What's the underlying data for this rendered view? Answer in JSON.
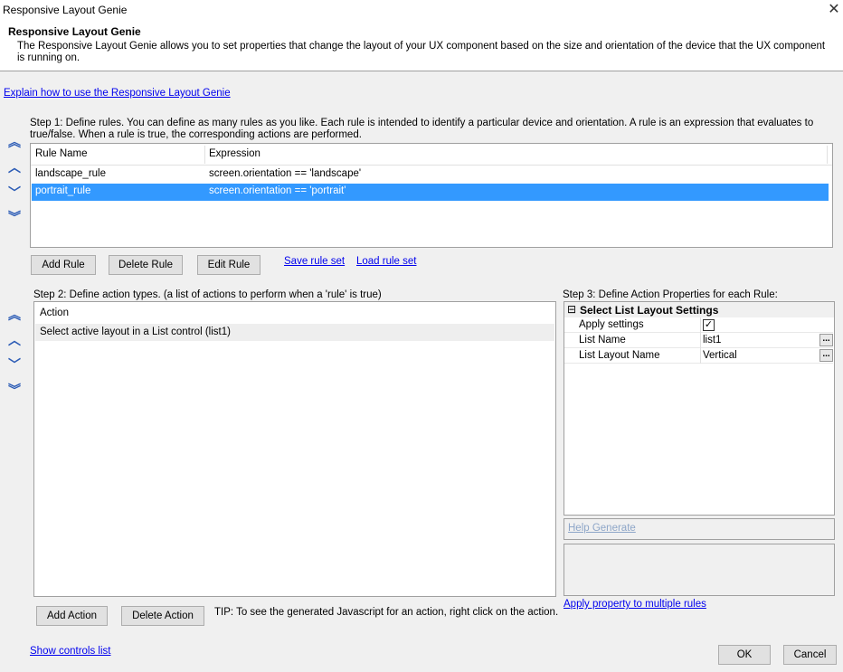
{
  "window": {
    "title": "Responsive Layout Genie",
    "close_glyph": "✕"
  },
  "header": {
    "title": "Responsive Layout Genie",
    "description": "The Responsive Layout Genie allows you to set properties that change the layout of your UX component based on the size and orientation of the device that the UX component is running on."
  },
  "explain_link": "Explain how to use the Responsive Layout Genie",
  "step1": {
    "instructions": "Step 1: Define rules. You can define as many rules as you like. Each rule is intended to identify a particular device and orientation. A rule is an expression that evaluates to true/false. When a rule is true, the corresponding actions are performed.",
    "columns": [
      "Rule Name",
      "Expression"
    ],
    "rows": [
      {
        "name": "landscape_rule",
        "expression": "screen.orientation == 'landscape'"
      },
      {
        "name": "portrait_rule",
        "expression": "screen.orientation == 'portrait'"
      }
    ],
    "selected_row": 1,
    "add_rule": "Add Rule",
    "delete_rule": "Delete Rule",
    "edit_rule": "Edit Rule",
    "save_rule_set": "Save rule set",
    "load_rule_set": "Load rule set"
  },
  "move_arrows": {
    "top": "︽",
    "up": "︿",
    "down": "﹀",
    "bottom": "︾"
  },
  "step2": {
    "instructions": "Step 2: Define action types.  (a list of actions to perform when a 'rule' is true)",
    "column": "Action",
    "rows": [
      "Select active layout in a List control (list1)"
    ],
    "add_action": "Add Action",
    "delete_action": "Delete Action",
    "tip": "TIP: To see the generated Javascript for an action, right click on the action."
  },
  "step3": {
    "instructions": "Step 3: Define Action Properties for each Rule:",
    "group_toggle": "⊟",
    "group_title": "Select List Layout Settings",
    "properties": {
      "apply_settings": {
        "label": "Apply settings",
        "checked": "✓"
      },
      "list_name": {
        "label": "List Name",
        "value": "list1",
        "button": "..."
      },
      "list_layout_name": {
        "label": "List Layout Name",
        "value": "Vertical",
        "button": "..."
      }
    },
    "help_generate": "Help Generate",
    "apply_multiple": "Apply property to multiple rules"
  },
  "footer": {
    "show_controls": "Show controls list",
    "ok": "OK",
    "cancel": "Cancel"
  }
}
